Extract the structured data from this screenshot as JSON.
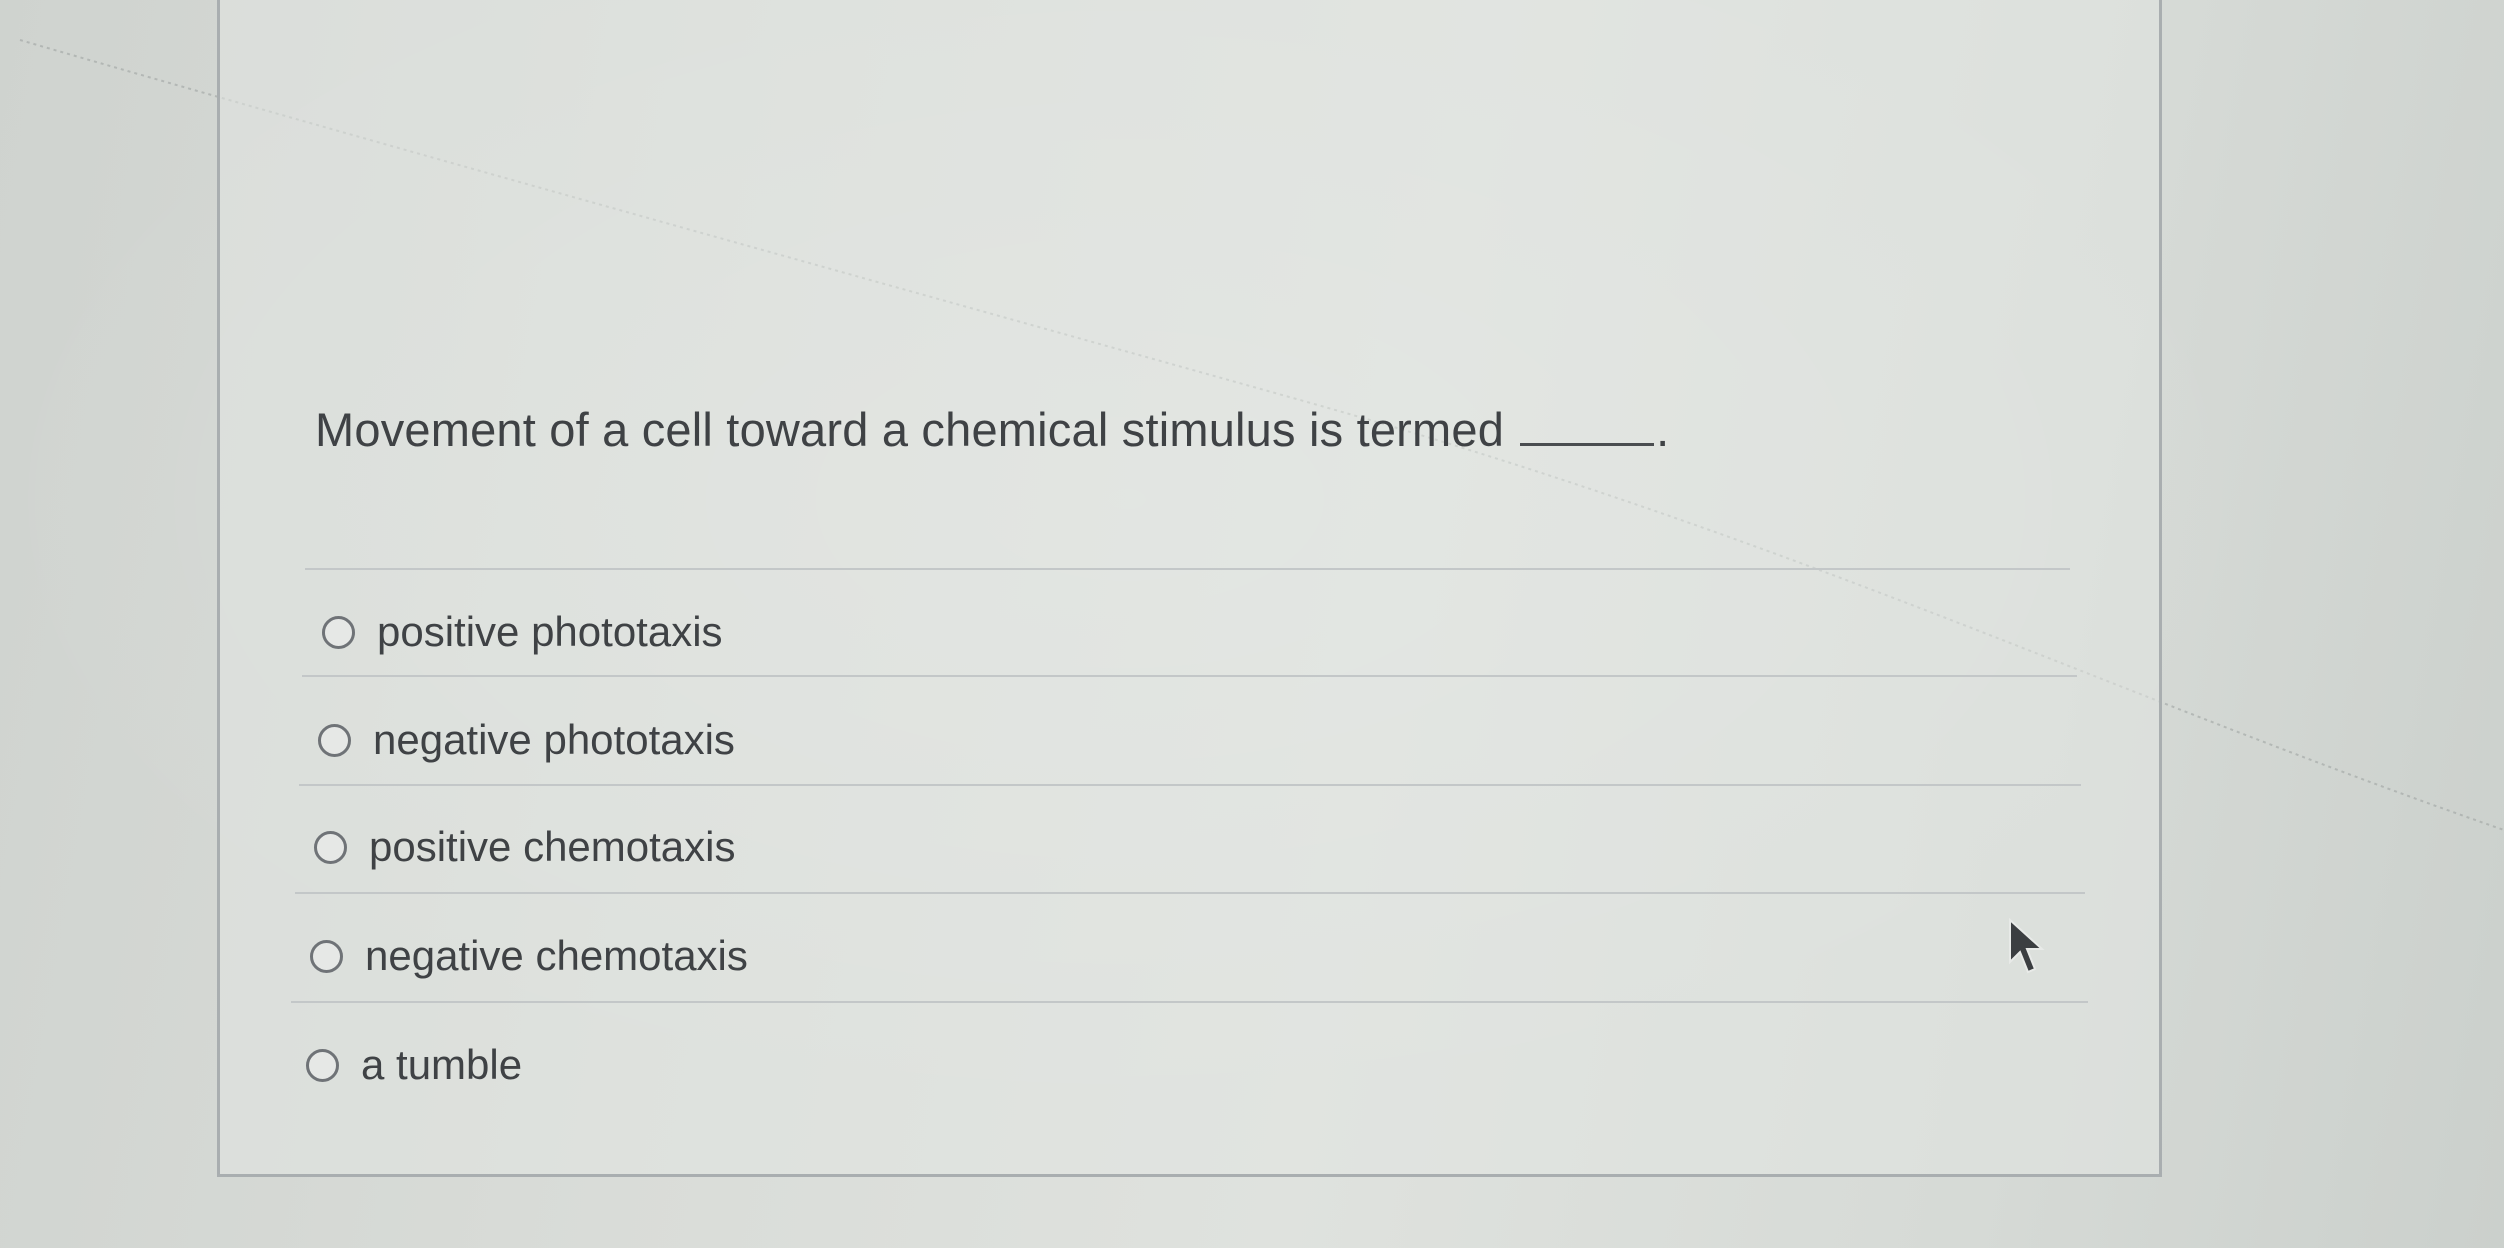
{
  "question": {
    "text": "Movement of a cell toward a chemical stimulus is termed",
    "end_punctuation": "."
  },
  "options": [
    {
      "label": "positive phototaxis",
      "selected": false
    },
    {
      "label": "negative phototaxis",
      "selected": false
    },
    {
      "label": "positive chemotaxis",
      "selected": false
    },
    {
      "label": "negative chemotaxis",
      "selected": false
    },
    {
      "label": "a tumble",
      "selected": false
    }
  ],
  "colors": {
    "text": "#3f4245",
    "radio_border": "#6f7377",
    "panel_border": "#a9aeb0",
    "divider": "#c3c7c8"
  },
  "icons": {
    "option_control": "radio-button-icon",
    "pointer": "mouse-pointer-icon"
  }
}
